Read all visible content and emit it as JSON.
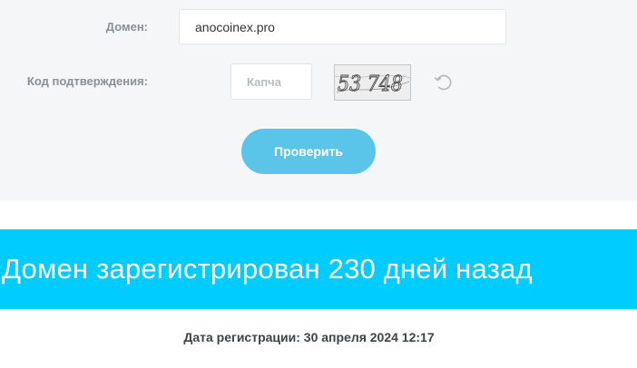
{
  "form": {
    "domain_label": "Домен:",
    "domain_value": "anocoinex.pro",
    "code_label": "Код подтверждения:",
    "captcha_placeholder": "Капча",
    "captcha_text": "53 748",
    "refresh_icon": "refresh-icon",
    "check_button_label": "Проверить"
  },
  "result": {
    "banner_text": "Домен зарегистрирован 230 дней назад",
    "registration_label": "Дата регистрации:",
    "registration_date": "30 апреля 2024 12:17"
  },
  "colors": {
    "panel_bg": "#f4f6f7",
    "button": "#5bc5e9",
    "banner": "#00ccff",
    "label_text": "#8a8f94",
    "body_text": "#3d4347"
  }
}
